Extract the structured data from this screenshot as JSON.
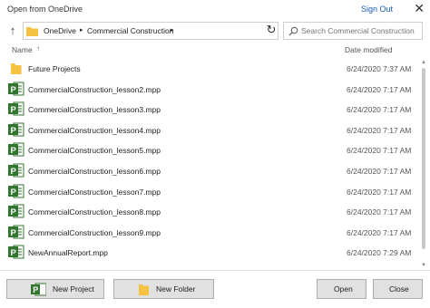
{
  "title": "Open from OneDrive",
  "sign_out": "Sign Out",
  "breadcrumb": [
    "OneDrive",
    "Commercial Construction"
  ],
  "search_placeholder": "Search Commercial Construction",
  "columns": {
    "name": "Name",
    "date": "Date modified"
  },
  "rows": [
    {
      "type": "folder",
      "name": "Future Projects",
      "date": "6/24/2020 7:37 AM"
    },
    {
      "type": "project",
      "name": "CommercialConstruction_lesson2.mpp",
      "date": "6/24/2020 7:17 AM"
    },
    {
      "type": "project",
      "name": "CommercialConstruction_lesson3.mpp",
      "date": "6/24/2020 7:17 AM"
    },
    {
      "type": "project",
      "name": "CommercialConstruction_lesson4.mpp",
      "date": "6/24/2020 7:17 AM"
    },
    {
      "type": "project",
      "name": "CommercialConstruction_lesson5.mpp",
      "date": "6/24/2020 7:17 AM"
    },
    {
      "type": "project",
      "name": "CommercialConstruction_lesson6.mpp",
      "date": "6/24/2020 7:17 AM"
    },
    {
      "type": "project",
      "name": "CommercialConstruction_lesson7.mpp",
      "date": "6/24/2020 7:17 AM"
    },
    {
      "type": "project",
      "name": "CommercialConstruction_lesson8.mpp",
      "date": "6/24/2020 7:17 AM"
    },
    {
      "type": "project",
      "name": "CommercialConstruction_lesson9.mpp",
      "date": "6/24/2020 7:17 AM"
    },
    {
      "type": "project",
      "name": "NewAnnualReport.mpp",
      "date": "6/24/2020 7:29 AM"
    }
  ],
  "buttons": {
    "new_project": "New Project",
    "new_folder": "New Folder",
    "open": "Open",
    "close": "Close"
  },
  "colors": {
    "project_green": "#31752f",
    "folder_yellow": "#f5c242",
    "link_blue": "#1a5fb4"
  }
}
